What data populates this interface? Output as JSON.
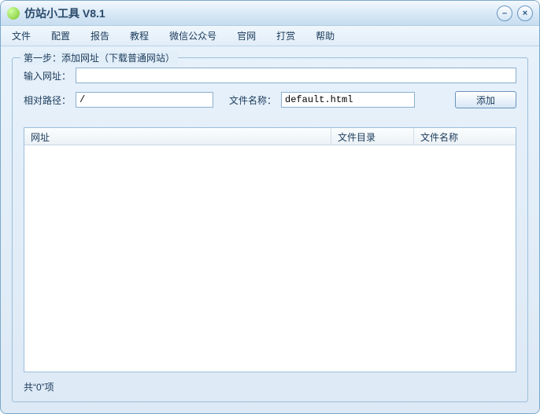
{
  "title": "仿站小工具 V8.1",
  "menubar": {
    "file": "文件",
    "config": "配置",
    "report": "报告",
    "tutorial": "教程",
    "wechat": "微信公众号",
    "website": "官网",
    "donate": "打赏",
    "help": "帮助"
  },
  "step1": {
    "legend": "第一步：添加网址（下载普通网站）",
    "url_label": "输入网址：",
    "url_value": "",
    "path_label": "相对路径：",
    "path_value": "/",
    "fname_label": "文件名称：",
    "fname_value": "default.html",
    "add_btn": "添加"
  },
  "table": {
    "col_url": "网址",
    "col_dir": "文件目录",
    "col_name": "文件名称"
  },
  "status": "共“0”项"
}
